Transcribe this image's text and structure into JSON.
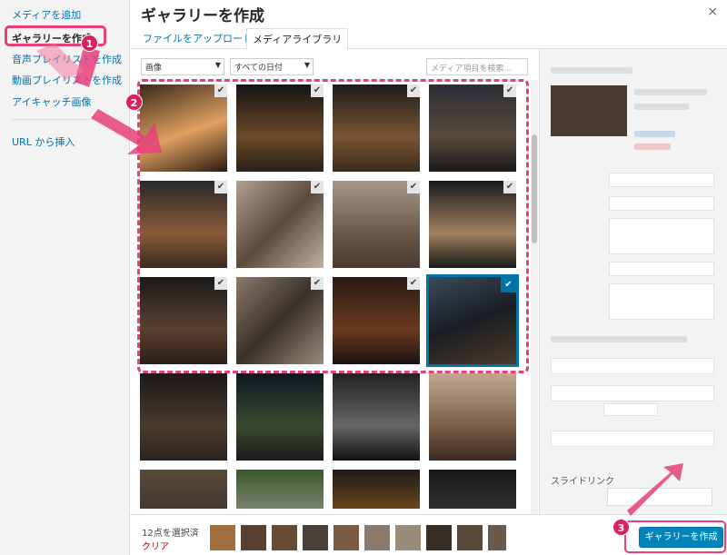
{
  "sidebar": {
    "items": [
      {
        "label": "メディアを追加"
      },
      {
        "label": "ギャラリーを作成"
      },
      {
        "label": "音声プレイリストを作成"
      },
      {
        "label": "動画プレイリストを作成"
      },
      {
        "label": "アイキャッチ画像"
      },
      {
        "label": "URL から挿入"
      }
    ]
  },
  "header": {
    "title": "ギャラリーを作成",
    "close": "×"
  },
  "tabs": [
    {
      "label": "ファイルをアップロード"
    },
    {
      "label": "メディアライブラリ"
    }
  ],
  "filters": {
    "type": "画像",
    "date": "すべての日付",
    "search_placeholder": "メディア項目を検索..."
  },
  "details": {
    "slide_link_label": "スライドリンク"
  },
  "footer": {
    "selected_count": "12点を選択済",
    "clear": "クリア",
    "create_button": "ギャラリーを作成"
  },
  "annotations": {
    "badge1": "1",
    "badge2": "2",
    "badge3": "3"
  },
  "checkmark": "✔",
  "colors": {
    "accent": "#0073aa",
    "highlight": "#e63f7a",
    "button": "#0085ba"
  }
}
